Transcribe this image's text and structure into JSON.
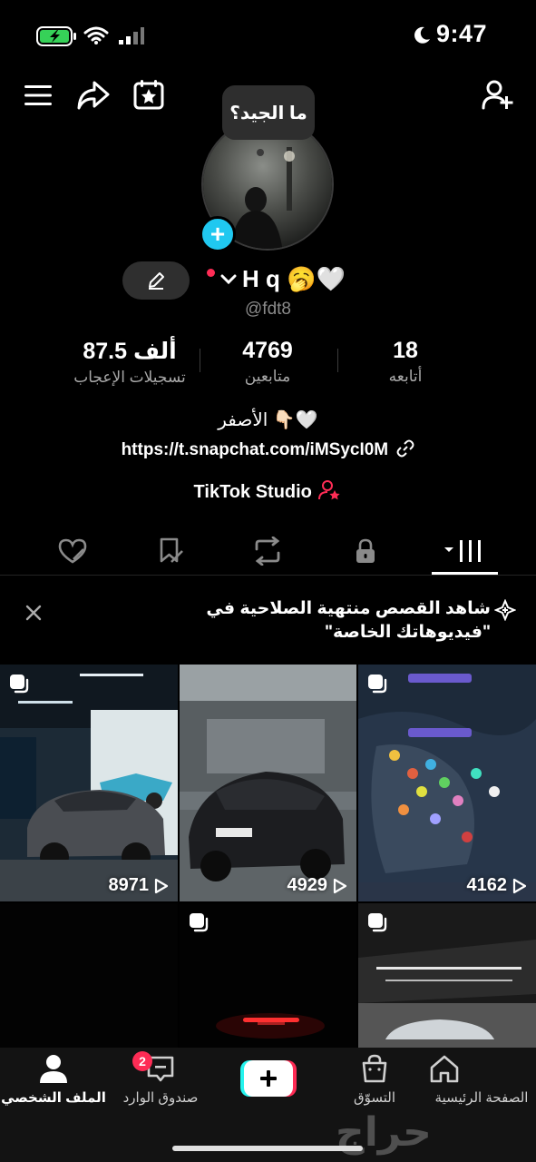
{
  "status_bar": {
    "time": "9:47"
  },
  "profile": {
    "tooltip": "ما الجيد؟",
    "display_name": "H q 🥱🤍",
    "handle": "@fdt8",
    "stats": [
      {
        "value": "18",
        "label": "أتابعه"
      },
      {
        "value": "4769",
        "label": "متابعين"
      },
      {
        "value": "87.5 ألف",
        "label": "تسجيلات الإعجاب"
      }
    ],
    "bio": "الأصفر 👇🏻🤍",
    "link": "https://t.snapchat.com/iMSycI0M",
    "studio": "TikTok Studio"
  },
  "banner": {
    "text": "شاهد القصص منتهية الصلاحية في \"فيديوهاتك الخاصة\""
  },
  "videos": [
    {
      "views": "8971"
    },
    {
      "views": "4929"
    },
    {
      "views": "4162"
    }
  ],
  "nav": {
    "profile": "الملف الشخصي",
    "inbox": "صندوق الوارد",
    "inbox_badge": "2",
    "shop": "التسوّق",
    "home": "الصفحة الرئيسية"
  },
  "watermark": "حراج",
  "colors": {
    "accent": "#fe2c55",
    "cyan": "#20c8f0",
    "background": "#000000"
  }
}
